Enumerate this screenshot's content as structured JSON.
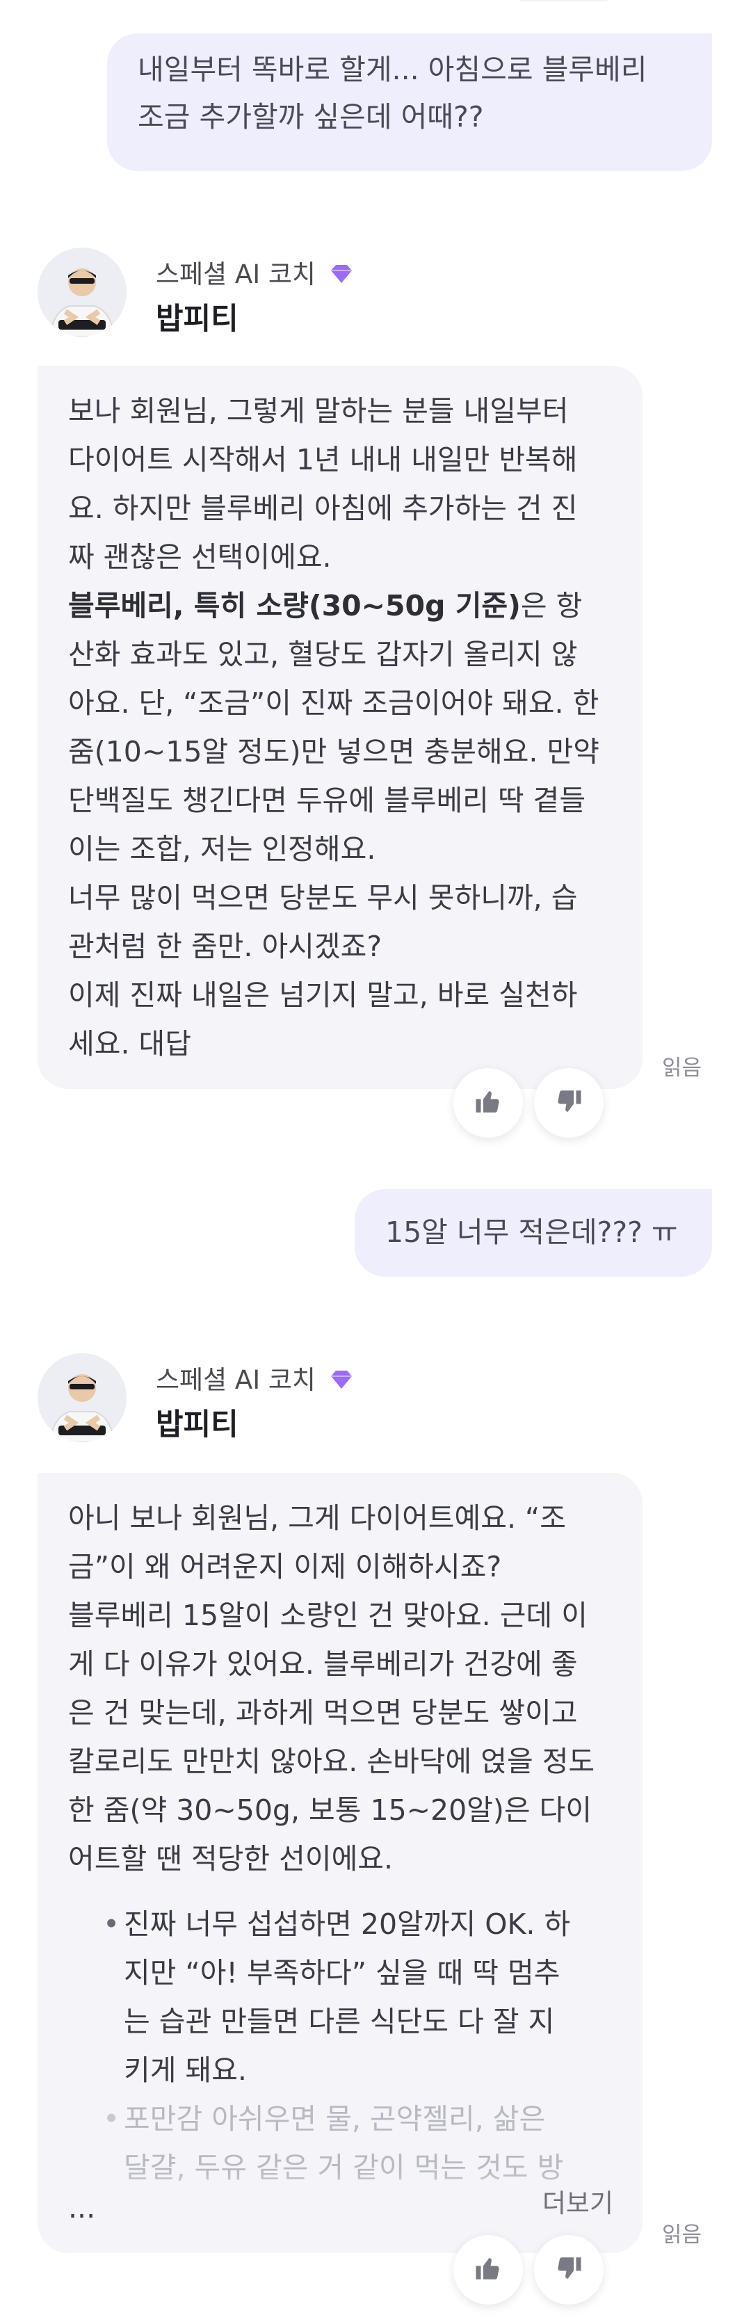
{
  "colors": {
    "accent_gem": "#9b6bf5",
    "user_bubble": "#efeefd",
    "ai_bubble": "#f4f4f9"
  },
  "messages": [
    {
      "role": "user",
      "lines": [
        "내일부터 똑바로 할게... 아침으로 블루베리",
        "조금 추가할까 싶은데 어때??"
      ]
    },
    {
      "role": "ai",
      "coach_label": "스페셜 AI 코치",
      "coach_name": "밥피티",
      "lines": [
        "보나 회원님, 그렇게 말하는 분들 내일부터",
        "다이어트 시작해서 1년 내내 내일만 반복해",
        "요. 하지만 블루베리 아침에 추가하는 건 진",
        "짜 괜찮은 선택이에요."
      ],
      "bold_lead": "블루베리, 특히 소량(30~50g 기준)",
      "bold_rest": "은 항",
      "lines2": [
        "산화 효과도 있고, 혈당도 갑자기 올리지 않",
        "아요. 단, “조금”이 진짜 조금이어야 돼요. 한",
        "줌(10~15알 정도)만 넣으면 충분해요. 만약",
        "단백질도 챙긴다면 두유에 블루베리 딱 곁들",
        "이는 조합, 저는 인정해요.",
        "너무 많이 먹으면 당분도 무시 못하니까, 습",
        "관처럼 한 줌만. 아시겠죠?",
        "이제 진짜 내일은 넘기지 말고, 바로 실천하",
        "세요. 대답"
      ],
      "read_label": "읽음"
    },
    {
      "role": "user",
      "lines": [
        "15알 너무 적은데??? ㅠ"
      ]
    },
    {
      "role": "ai",
      "coach_label": "스페셜 AI 코치",
      "coach_name": "밥피티",
      "lines": [
        "아니 보나 회원님, 그게 다이어트예요. “조",
        "금”이 왜 어려운지 이제 이해하시죠?",
        "블루베리 15알이 소량인 건 맞아요. 근데 이",
        "게 다 이유가 있어요. 블루베리가 건강에 좋",
        "은 건 맞는데, 과하게 먹으면 당분도 쌓이고",
        "칼로리도 만만치 않아요. 손바닥에 얹을 정도",
        "한 줌(약 30~50g, 보통 15~20알)은 다이",
        "어트할 땐 적당한 선이에요."
      ],
      "bullets": [
        [
          "진짜 너무 섭섭하면 20알까지 OK. 하",
          "지만 “아! 부족하다” 싶을 때 딱 멈추",
          "는 습관 만들면 다른 식단도 다 잘 지",
          "키게 돼요."
        ],
        [
          "포만감 아쉬우면 물, 곤약젤리, 삶은",
          "달걀, 두유 같은 거 같이 먹는 것도 방"
        ]
      ],
      "ellipsis": "...",
      "more_label": "더보기",
      "read_label": "읽음"
    }
  ]
}
